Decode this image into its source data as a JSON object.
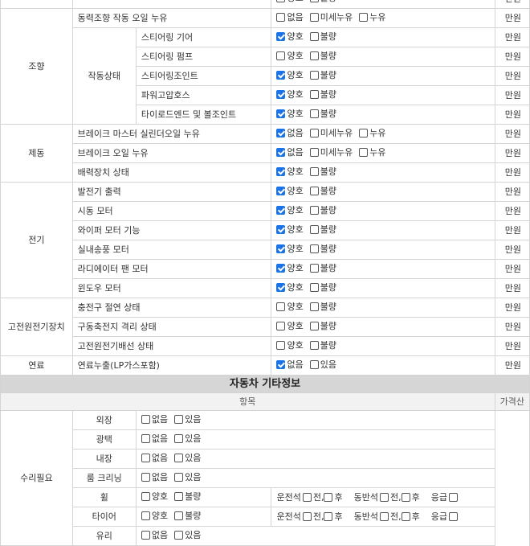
{
  "top_row": {
    "options": [
      {
        "label": "양호",
        "checked": false
      },
      {
        "label": "불량",
        "checked": false
      }
    ],
    "price": "만원"
  },
  "steering": {
    "category": "조향",
    "oil_leak": {
      "label": "동력조향 작동 오일 누유",
      "options": [
        {
          "label": "없음",
          "checked": false
        },
        {
          "label": "미세누유",
          "checked": false
        },
        {
          "label": "누유",
          "checked": false
        }
      ],
      "price": "만원"
    },
    "sub_label": "작동상태",
    "items": [
      {
        "label": "스티어링 기어",
        "options": [
          {
            "label": "양호",
            "checked": true
          },
          {
            "label": "불량",
            "checked": false
          }
        ],
        "price": "만원"
      },
      {
        "label": "스티어링 펌프",
        "options": [
          {
            "label": "양호",
            "checked": false
          },
          {
            "label": "불량",
            "checked": false
          }
        ],
        "price": "만원"
      },
      {
        "label": "스티어링조인트",
        "options": [
          {
            "label": "양호",
            "checked": true
          },
          {
            "label": "불량",
            "checked": false
          }
        ],
        "price": "만원"
      },
      {
        "label": "파워고압호스",
        "options": [
          {
            "label": "양호",
            "checked": true
          },
          {
            "label": "불량",
            "checked": false
          }
        ],
        "price": "만원"
      },
      {
        "label": "타이로드엔드 및 볼조인트",
        "options": [
          {
            "label": "양호",
            "checked": true
          },
          {
            "label": "불량",
            "checked": false
          }
        ],
        "price": "만원"
      }
    ]
  },
  "brake": {
    "category": "제동",
    "items": [
      {
        "label": "브레이크 마스터 실린더오일 누유",
        "options": [
          {
            "label": "없음",
            "checked": true
          },
          {
            "label": "미세누유",
            "checked": false
          },
          {
            "label": "누유",
            "checked": false
          }
        ],
        "price": "만원"
      },
      {
        "label": "브레이크 오일 누유",
        "options": [
          {
            "label": "없음",
            "checked": true
          },
          {
            "label": "미세누유",
            "checked": false
          },
          {
            "label": "누유",
            "checked": false
          }
        ],
        "price": "만원"
      },
      {
        "label": "배력장치 상태",
        "options": [
          {
            "label": "양호",
            "checked": true
          },
          {
            "label": "불량",
            "checked": false
          }
        ],
        "price": "만원"
      }
    ]
  },
  "electric": {
    "category": "전기",
    "items": [
      {
        "label": "발전기 출력",
        "options": [
          {
            "label": "양호",
            "checked": true
          },
          {
            "label": "불량",
            "checked": false
          }
        ],
        "price": "만원"
      },
      {
        "label": "시동 모터",
        "options": [
          {
            "label": "양호",
            "checked": true
          },
          {
            "label": "불량",
            "checked": false
          }
        ],
        "price": "만원"
      },
      {
        "label": "와이퍼 모터 기능",
        "options": [
          {
            "label": "양호",
            "checked": true
          },
          {
            "label": "불량",
            "checked": false
          }
        ],
        "price": "만원"
      },
      {
        "label": "실내송풍 모터",
        "options": [
          {
            "label": "양호",
            "checked": true
          },
          {
            "label": "불량",
            "checked": false
          }
        ],
        "price": "만원"
      },
      {
        "label": "라디에이터 팬 모터",
        "options": [
          {
            "label": "양호",
            "checked": true
          },
          {
            "label": "불량",
            "checked": false
          }
        ],
        "price": "만원"
      },
      {
        "label": "윈도우 모터",
        "options": [
          {
            "label": "양호",
            "checked": true
          },
          {
            "label": "불량",
            "checked": false
          }
        ],
        "price": "만원"
      }
    ]
  },
  "hv": {
    "category": "고전원전기장치",
    "items": [
      {
        "label": "충전구 절연 상태",
        "options": [
          {
            "label": "양호",
            "checked": false
          },
          {
            "label": "불량",
            "checked": false
          }
        ],
        "price": "만원"
      },
      {
        "label": "구동축전지 격리 상태",
        "options": [
          {
            "label": "양호",
            "checked": false
          },
          {
            "label": "불량",
            "checked": false
          }
        ],
        "price": "만원"
      },
      {
        "label": "고전원전기배선 상태",
        "options": [
          {
            "label": "양호",
            "checked": false
          },
          {
            "label": "불량",
            "checked": false
          }
        ],
        "price": "만원"
      }
    ]
  },
  "fuel": {
    "category": "연료",
    "items": [
      {
        "label": "연료누출(LP가스포함)",
        "options": [
          {
            "label": "없음",
            "checked": true
          },
          {
            "label": "있음",
            "checked": false
          }
        ],
        "price": "만원"
      }
    ]
  },
  "extra": {
    "title": "자동차 기타정보",
    "header_item": "항목",
    "header_price": "가격산",
    "category": "수리필요",
    "items": [
      {
        "label": "외장",
        "options": [
          {
            "label": "없음",
            "checked": false
          },
          {
            "label": "있음",
            "checked": false
          }
        ]
      },
      {
        "label": "광택",
        "options": [
          {
            "label": "없음",
            "checked": false
          },
          {
            "label": "있음",
            "checked": false
          }
        ]
      },
      {
        "label": "내장",
        "options": [
          {
            "label": "없음",
            "checked": false
          },
          {
            "label": "있음",
            "checked": false
          }
        ]
      },
      {
        "label": "룸 크리닝",
        "options": [
          {
            "label": "없음",
            "checked": false
          },
          {
            "label": "있음",
            "checked": false
          }
        ]
      },
      {
        "label": "휠",
        "options": [
          {
            "label": "양호",
            "checked": false
          },
          {
            "label": "불량",
            "checked": false
          }
        ],
        "seats": [
          {
            "label": "운전석",
            "opts": [
              "전",
              "후"
            ]
          },
          {
            "label": "동반석",
            "opts": [
              "전",
              "후"
            ]
          },
          {
            "label": "응급",
            "opts": [
              ""
            ]
          }
        ]
      },
      {
        "label": "타이어",
        "options": [
          {
            "label": "양호",
            "checked": false
          },
          {
            "label": "불량",
            "checked": false
          }
        ],
        "seats": [
          {
            "label": "운전석",
            "opts": [
              "전",
              "후"
            ]
          },
          {
            "label": "동반석",
            "opts": [
              "전",
              "후"
            ]
          },
          {
            "label": "응급",
            "opts": [
              ""
            ]
          }
        ]
      },
      {
        "label": "유리",
        "options": [
          {
            "label": "없음",
            "checked": false
          },
          {
            "label": "있음",
            "checked": false
          }
        ]
      }
    ]
  }
}
